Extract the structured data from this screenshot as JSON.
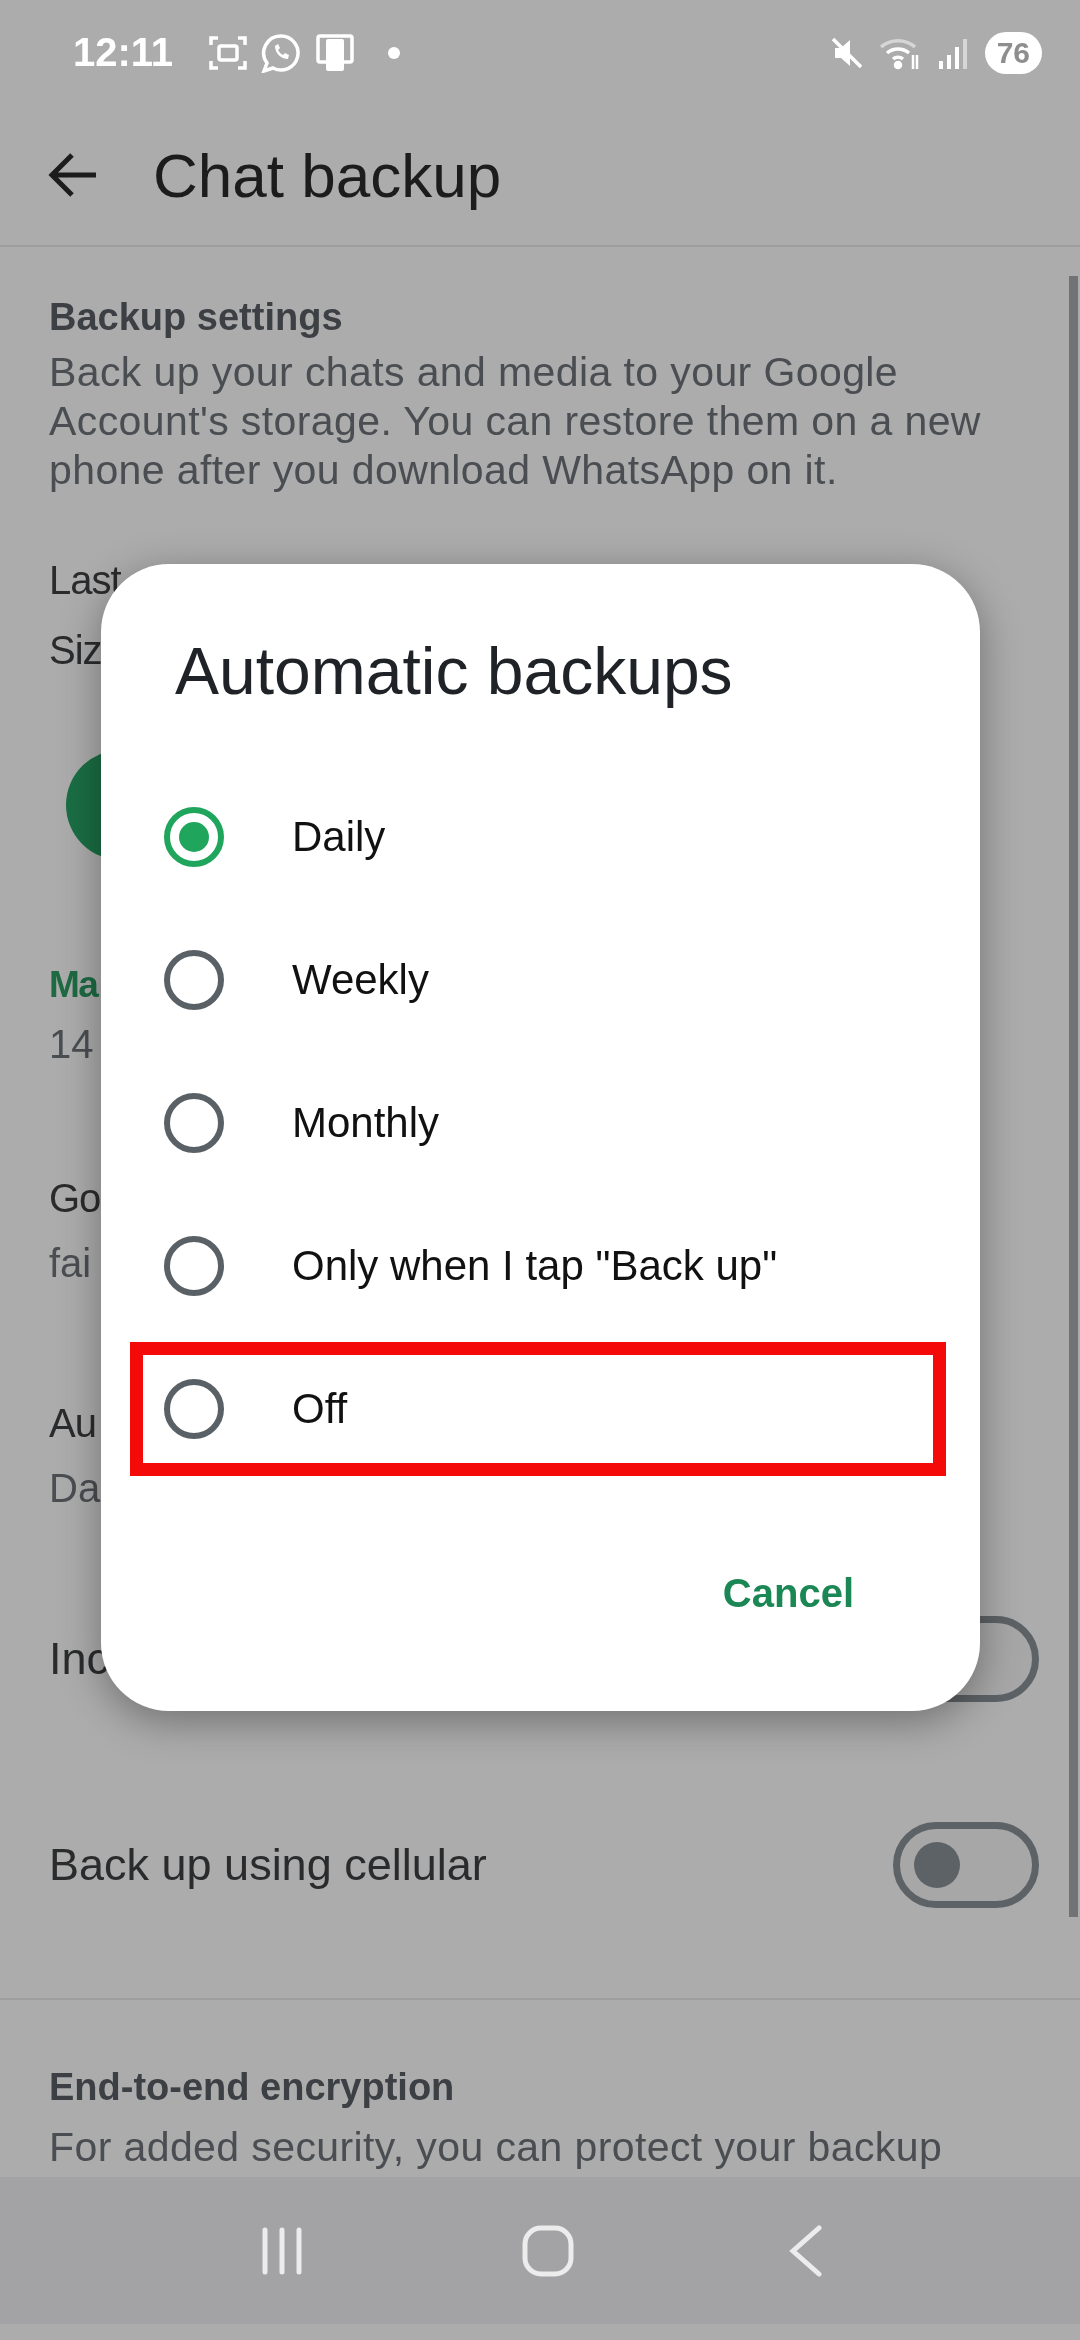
{
  "status_bar": {
    "time": "12:11",
    "battery": "76"
  },
  "app_bar": {
    "title": "Chat backup"
  },
  "backup_settings": {
    "heading": "Backup settings",
    "description": "Back up your chats and media to your Google Account's storage. You can restore them on a new phone after you download WhatsApp on it."
  },
  "details": [
    {
      "text": "Last"
    },
    {
      "text": "Siz"
    }
  ],
  "settings": [
    {
      "title": "Ma",
      "subtitle": "14",
      "kind": "accent"
    },
    {
      "title": "Go",
      "subtitle": "fai",
      "kind": "plain"
    },
    {
      "title": "Au",
      "subtitle": "Da",
      "kind": "plain"
    }
  ],
  "toggles": [
    {
      "label": "Inc",
      "on": false
    },
    {
      "label": "Back up using cellular",
      "on": false
    }
  ],
  "encryption": {
    "heading": "End-to-end encryption",
    "description": "For added security, you can protect your backup"
  },
  "dialog": {
    "title": "Automatic backups",
    "options": [
      {
        "label": "Daily",
        "selected": true,
        "highlighted": false
      },
      {
        "label": "Weekly",
        "selected": false,
        "highlighted": false
      },
      {
        "label": "Monthly",
        "selected": false,
        "highlighted": false
      },
      {
        "label": "Only when I tap \"Back up\"",
        "selected": false,
        "highlighted": false
      },
      {
        "label": "Off",
        "selected": false,
        "highlighted": true
      }
    ],
    "cancel": "Cancel"
  }
}
